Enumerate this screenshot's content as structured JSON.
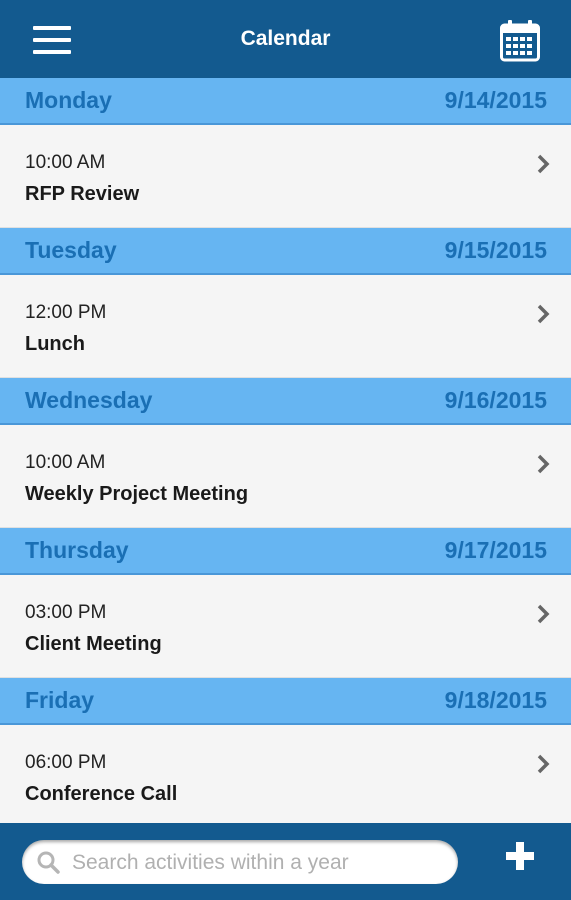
{
  "header": {
    "title": "Calendar",
    "menu_icon": "hamburger-menu-icon",
    "calendar_icon": "calendar-icon"
  },
  "days": [
    {
      "day": "Monday",
      "date": "9/14/2015",
      "events": [
        {
          "time": "10:00 AM",
          "title": "RFP Review"
        }
      ]
    },
    {
      "day": "Tuesday",
      "date": "9/15/2015",
      "events": [
        {
          "time": "12:00 PM",
          "title": "Lunch"
        }
      ]
    },
    {
      "day": "Wednesday",
      "date": "9/16/2015",
      "events": [
        {
          "time": "10:00 AM",
          "title": "Weekly Project Meeting"
        }
      ]
    },
    {
      "day": "Thursday",
      "date": "9/17/2015",
      "events": [
        {
          "time": "03:00 PM",
          "title": "Client Meeting"
        }
      ]
    },
    {
      "day": "Friday",
      "date": "9/18/2015",
      "events": [
        {
          "time": "06:00 PM",
          "title": "Conference Call"
        }
      ]
    }
  ],
  "footer": {
    "search_placeholder": "Search activities within a year",
    "search_value": "",
    "add_icon": "plus-icon"
  },
  "colors": {
    "bar": "#135a8f",
    "day_header_bg": "#66b5f2",
    "day_header_text": "#1a6fb4",
    "list_bg": "#f5f5f5"
  }
}
